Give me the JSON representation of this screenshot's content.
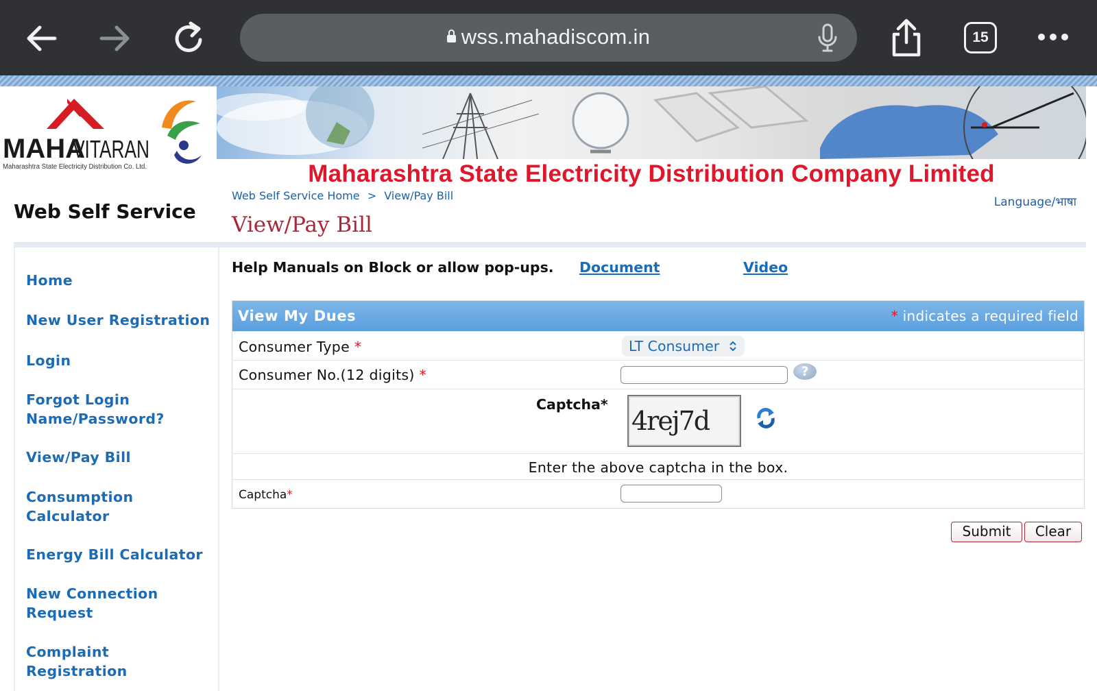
{
  "browser": {
    "url": "wss.mahadiscom.in",
    "tab_count": "15"
  },
  "header": {
    "logo_text_a": "MAHA",
    "logo_text_b": "VITARAN",
    "logo_subtitle": "Maharashtra State Electricity Distribution Co. Ltd.",
    "company_name": "Maharashtra State Electricity Distribution Company Limited"
  },
  "site": {
    "title": "Web Self Service",
    "breadcrumb": [
      "Web Self Service Home",
      "View/Pay Bill"
    ],
    "breadcrumb_sep": ">",
    "page_heading": "View/Pay Bill",
    "language_link": "Language/भाषा"
  },
  "sidebar": {
    "items": [
      {
        "label": "Home"
      },
      {
        "label": "New User Registration"
      },
      {
        "label": "Login"
      },
      {
        "label": "Forgot Login Name/Password?"
      },
      {
        "label": "View/Pay Bill"
      },
      {
        "label": "Consumption Calculator"
      },
      {
        "label": "Energy Bill Calculator"
      },
      {
        "label": "New Connection Request"
      },
      {
        "label": "Complaint Registration"
      }
    ]
  },
  "help": {
    "text": "Help Manuals on Block or allow pop-ups.",
    "document_link": " Document",
    "video_link": " Video"
  },
  "form": {
    "title": "View My Dues",
    "required_star": "*",
    "required_note": " indicates a required field",
    "consumer_type_label": "Consumer Type",
    "consumer_type_value": "LT Consumer",
    "consumer_no_label": "Consumer No.(12 digits)",
    "consumer_no_value": "",
    "captcha_heading": "Captcha*",
    "captcha_text": "4rej7d",
    "captcha_instruction": "Enter the above captcha in the box.",
    "captcha_label": "Captcha",
    "captcha_value": "",
    "help_symbol": "?",
    "submit_label": "Submit",
    "clear_label": "Clear"
  },
  "colors": {
    "brand_red": "#e0162b",
    "link_blue": "#1c6bb5",
    "form_header_blue": "#5b9fdd",
    "heading_maroon": "#a8273a"
  }
}
